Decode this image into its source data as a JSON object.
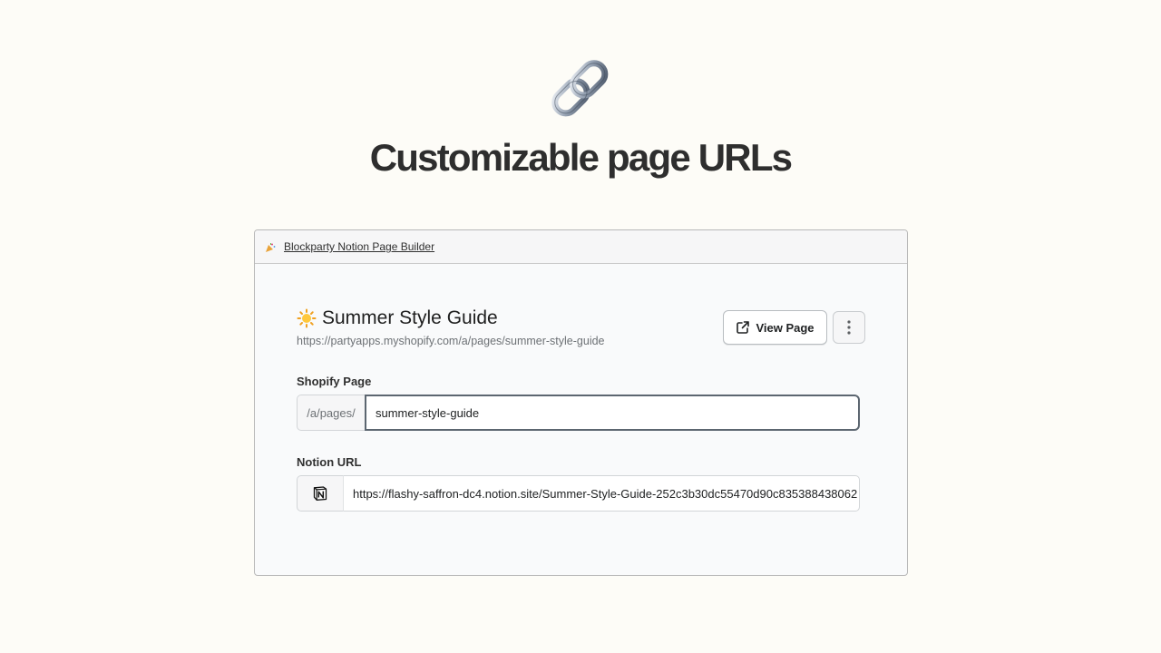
{
  "hero": {
    "icon": "link-chain-icon",
    "title": "Customizable page URLs"
  },
  "window": {
    "app_icon": "party-popper-icon",
    "app_name": "Blockparty Notion Page Builder"
  },
  "page": {
    "emoji_icon": "sun-icon",
    "title": "Summer Style Guide",
    "url": "https://partyapps.myshopify.com/a/pages/summer-style-guide",
    "view_button": "View Page",
    "more_icon": "vertical-ellipsis-icon"
  },
  "shopify_field": {
    "label": "Shopify Page",
    "prefix": "/a/pages/",
    "value": "summer-style-guide"
  },
  "notion_field": {
    "label": "Notion URL",
    "icon": "notion-logo-icon",
    "value": "https://flashy-saffron-dc4.notion.site/Summer-Style-Guide-252c3b30dc55470d90c835388438062"
  },
  "colors": {
    "background": "#fdfcf7",
    "window_bg": "#f9fafb",
    "title_text": "#2e2e2e",
    "muted_text": "#6d7175"
  }
}
